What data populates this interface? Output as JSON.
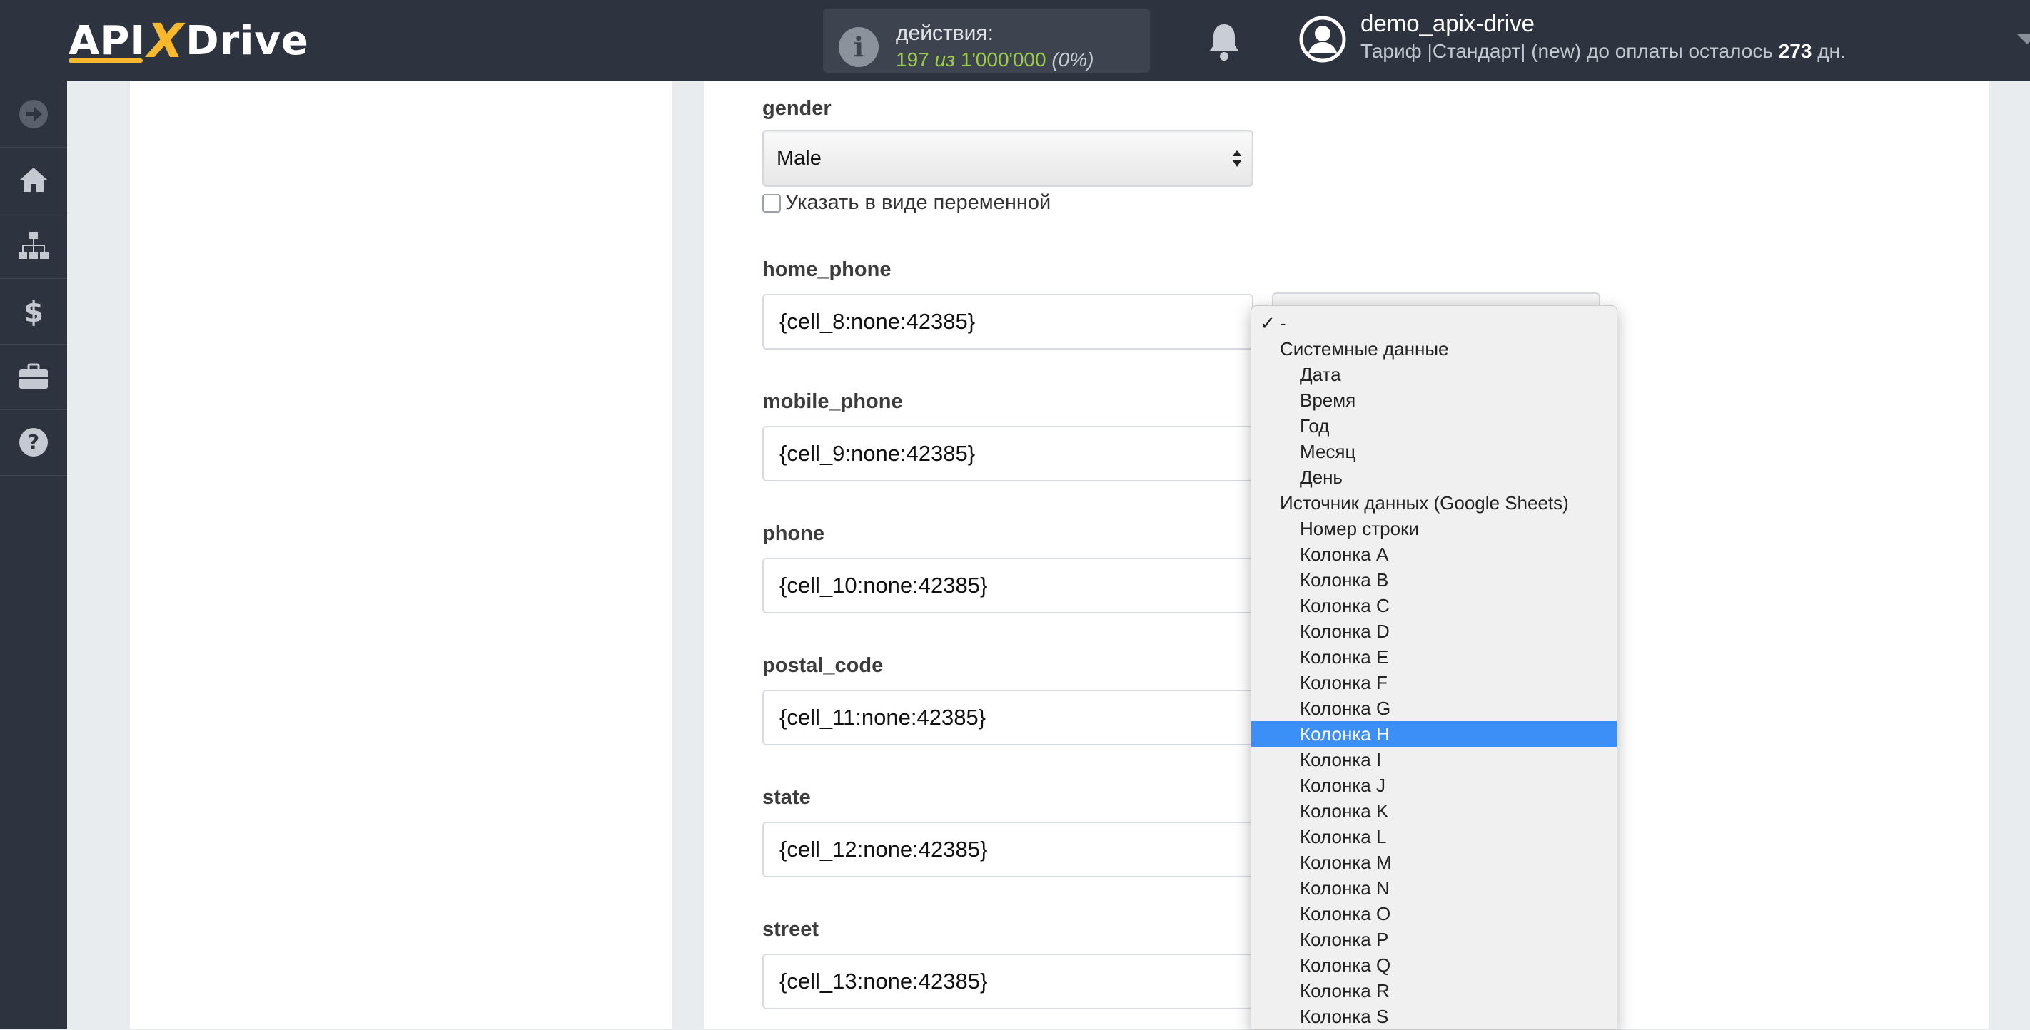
{
  "header": {
    "logo_left": "API",
    "logo_x": "X",
    "logo_right": "Drive",
    "actions_label": "действия:",
    "actions_used": "197",
    "actions_of": "из",
    "actions_total": "1'000'000",
    "actions_percent": "(0%)",
    "user_name": "demo_apix-drive",
    "plan_text": "Тариф |Стандарт| (new) до оплаты осталось",
    "plan_days": "273",
    "plan_days_suffix": "дн."
  },
  "sidebar": {
    "items": [
      {
        "icon": "arrow-right-circle-icon"
      },
      {
        "icon": "home-icon"
      },
      {
        "icon": "sitemap-icon"
      },
      {
        "icon": "dollar-icon"
      },
      {
        "icon": "briefcase-icon"
      },
      {
        "icon": "help-icon"
      }
    ]
  },
  "form": {
    "gender_label": "gender",
    "gender_value": "Male",
    "as_variable_label": "Указать в виде переменной",
    "fields": [
      {
        "label": "home_phone",
        "value": "{cell_8:none:42385}"
      },
      {
        "label": "mobile_phone",
        "value": "{cell_9:none:42385}"
      },
      {
        "label": "phone",
        "value": "{cell_10:none:42385}"
      },
      {
        "label": "postal_code",
        "value": "{cell_11:none:42385}"
      },
      {
        "label": "state",
        "value": "{cell_12:none:42385}"
      },
      {
        "label": "street",
        "value": "{cell_13:none:42385}"
      }
    ]
  },
  "dropdown": {
    "check_mark": "✓",
    "options": [
      {
        "label": "-",
        "level": 1,
        "checked": true
      },
      {
        "label": "Системные данные",
        "level": 1
      },
      {
        "label": "Дата",
        "level": 2
      },
      {
        "label": "Время",
        "level": 2
      },
      {
        "label": "Год",
        "level": 2
      },
      {
        "label": "Месяц",
        "level": 2
      },
      {
        "label": "День",
        "level": 2
      },
      {
        "label": "Источник данных (Google Sheets)",
        "level": 1
      },
      {
        "label": "Номер строки",
        "level": 2
      },
      {
        "label": "Колонка A",
        "level": 2
      },
      {
        "label": "Колонка B",
        "level": 2
      },
      {
        "label": "Колонка C",
        "level": 2
      },
      {
        "label": "Колонка D",
        "level": 2
      },
      {
        "label": "Колонка E",
        "level": 2
      },
      {
        "label": "Колонка F",
        "level": 2
      },
      {
        "label": "Колонка G",
        "level": 2
      },
      {
        "label": "Колонка H",
        "level": 2,
        "highlighted": true
      },
      {
        "label": "Колонка I",
        "level": 2
      },
      {
        "label": "Колонка J",
        "level": 2
      },
      {
        "label": "Колонка K",
        "level": 2
      },
      {
        "label": "Колонка L",
        "level": 2
      },
      {
        "label": "Колонка M",
        "level": 2
      },
      {
        "label": "Колонка N",
        "level": 2
      },
      {
        "label": "Колонка O",
        "level": 2
      },
      {
        "label": "Колонка P",
        "level": 2
      },
      {
        "label": "Колонка Q",
        "level": 2
      },
      {
        "label": "Колонка R",
        "level": 2
      },
      {
        "label": "Колонка S",
        "level": 2
      }
    ]
  },
  "colors": {
    "topbar": "#2d3440",
    "accent_logo": "#f7b92b",
    "actions_count": "#9ccc45",
    "dropdown_highlight": "#3b8ff6"
  }
}
